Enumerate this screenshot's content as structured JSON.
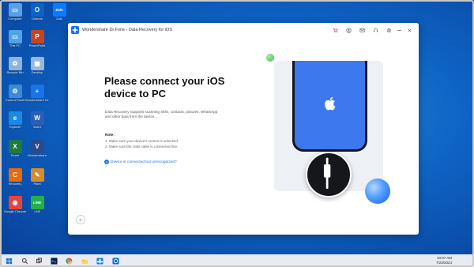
{
  "desktop": {
    "icons": [
      {
        "label": "Computer",
        "glyph": "▭",
        "color": "#5aa0e8"
      },
      {
        "label": "Outlook",
        "glyph": "O",
        "color": "#0a64c8"
      },
      {
        "label": "Zalo",
        "glyph": "Zalo",
        "color": "#0a7cff"
      },
      {
        "label": "This PC",
        "glyph": "▭",
        "color": "#4fa3e6"
      },
      {
        "label": "PowerPoint",
        "glyph": "P",
        "color": "#c9431f"
      },
      {
        "label": "Recycle Bin",
        "glyph": "♻",
        "color": "#8fb3d9"
      },
      {
        "label": "Desktop",
        "glyph": "▦",
        "color": "#9bb8d8"
      },
      {
        "label": "Control Panel",
        "glyph": "⚙",
        "color": "#3b8ad8"
      },
      {
        "label": "Wondershare Dr.Fone",
        "glyph": "+",
        "color": "#1a73e8"
      },
      {
        "label": "Explorer",
        "glyph": "e",
        "color": "#1e88e5"
      },
      {
        "label": "Word",
        "glyph": "W",
        "color": "#2b5fb4"
      },
      {
        "label": "Excel",
        "glyph": "X",
        "color": "#1f7a3e"
      },
      {
        "label": "Wondershare",
        "glyph": "V",
        "color": "#294a8c"
      },
      {
        "label": "Recovery",
        "glyph": "C",
        "color": "#e86a0c"
      },
      {
        "label": "Paint",
        "glyph": "✎",
        "color": "#d98a2a"
      },
      {
        "label": "Google Chrome",
        "glyph": "◉",
        "color": "#e8433a"
      },
      {
        "label": "LINE",
        "glyph": "LINE",
        "color": "#22b14c"
      }
    ]
  },
  "window": {
    "title": "Wondershare Dr.Fone - Data Recovery for iOS",
    "headline_line1": "Please connect your iOS",
    "headline_line2": "device to PC",
    "description": "Data Recovery supports scanning SMS, contacts, pictures, WhatsApp and other data from the device....",
    "note_title": "Note:",
    "notes": [
      "1. Make sure your device's screen is unlocked.",
      "2. Make sure the USB cable is connected fine."
    ],
    "help_link": "Device is connected but unrecognized?",
    "colors": {
      "accent": "#1a73e8",
      "phone": "#3e78ee",
      "orb": "#4f9bff",
      "dot": "#3dbf4d"
    }
  },
  "taskbar": {
    "time": "10:07 AM",
    "date": "7/23/2024",
    "apps": [
      "start-icon",
      "search-icon",
      "task-view-icon",
      "photoshop-icon",
      "file-explorer-icon",
      "chrome-icon",
      "drfone-icon",
      "app-icon"
    ]
  }
}
